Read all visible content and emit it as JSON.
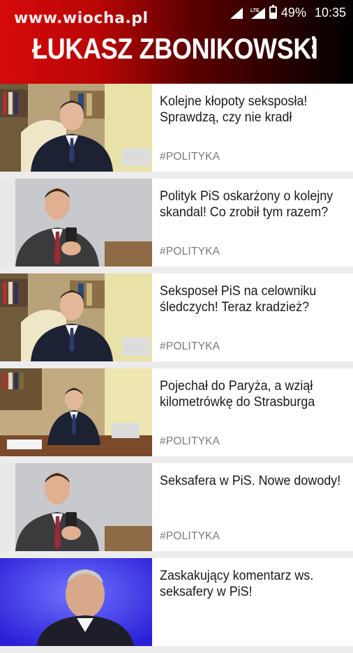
{
  "watermark": "www.wiocha.pl",
  "status_bar": {
    "network": "LTE",
    "battery_percent": "49%",
    "time": "10:35",
    "battery_level": 0.49
  },
  "header": {
    "title": "ŁUKASZ ZBONIKOWSKI",
    "menu_icon": "overflow-menu-icon"
  },
  "articles": [
    {
      "headline": "Kolejne kłopoty seksposła! Sprawdzą, czy nie kradł",
      "tag": "#POLITYKA",
      "image": "man-in-office-photo"
    },
    {
      "headline": "Polityk PiS oskarżony o kolejny skandal! Co zrobił tym razem?",
      "tag": "#POLITYKA",
      "image": "man-selfie-photo"
    },
    {
      "headline": "Seksposeł PiS na celowniku śledczych! Teraz kradzież?",
      "tag": "#POLITYKA",
      "image": "man-in-office-photo"
    },
    {
      "headline": "Pojechał do Paryża, a wziął kilometrówkę do Strasburga",
      "tag": "#POLITYKA",
      "image": "man-at-desk-photo"
    },
    {
      "headline": "Seksafera w PiS. Nowe dowody!",
      "tag": "#POLITYKA",
      "image": "man-selfie-photo"
    },
    {
      "headline": "Zaskakujący komentarz ws. seksafery w PiS!",
      "tag": "",
      "image": "man-blue-background-photo"
    }
  ],
  "colors": {
    "header_red": "#d50a0a",
    "header_black": "#000000",
    "tag_gray": "#7a7a7a",
    "card_bg": "#ffffff",
    "list_bg": "#ececec"
  }
}
